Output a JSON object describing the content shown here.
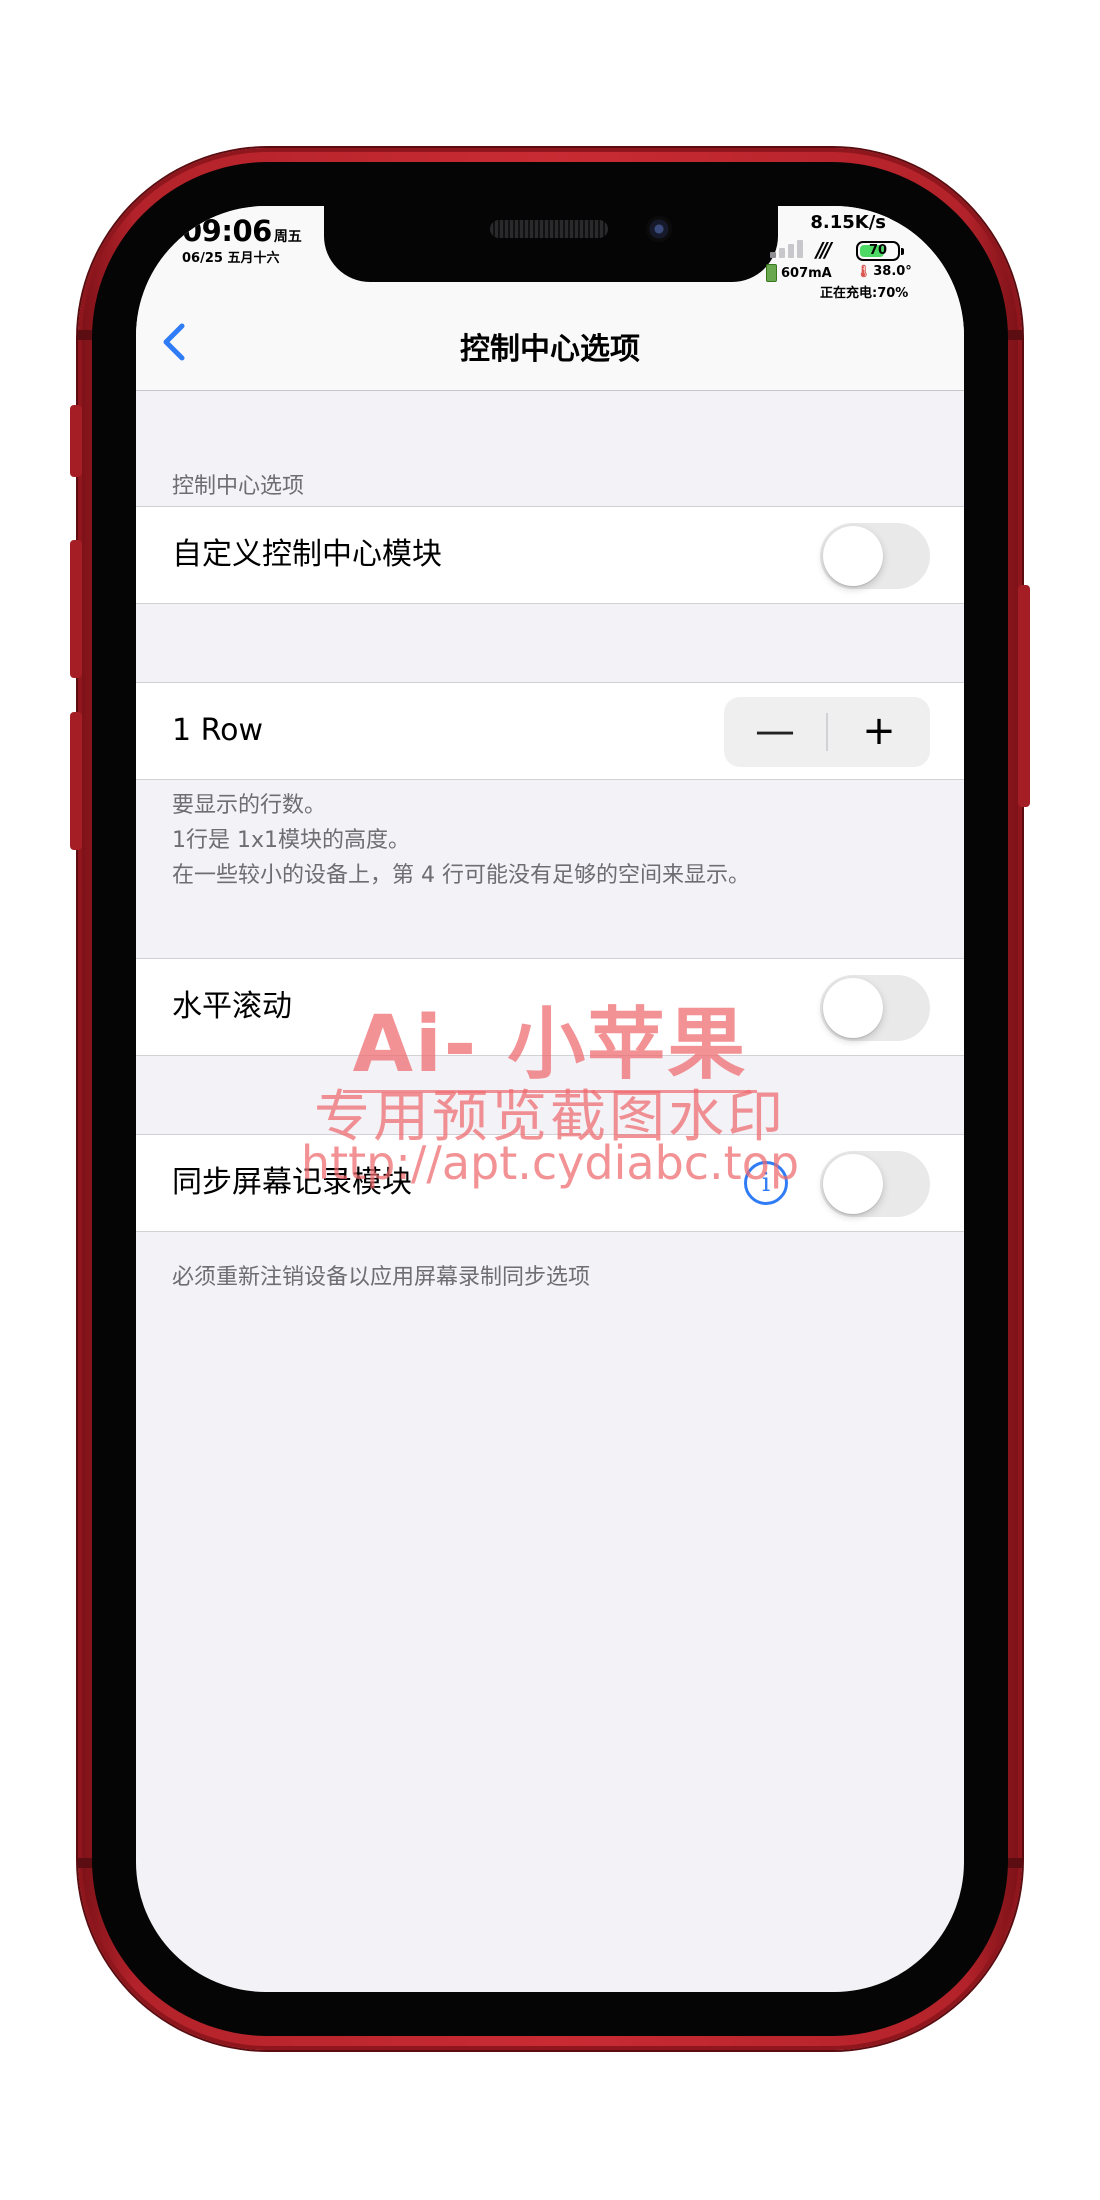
{
  "status_bar": {
    "time": "09:06",
    "weekday": "周五",
    "date": "06/25 五月十六",
    "net_speed": "8.15K/s",
    "carrier_glyph": "///",
    "battery_percent": "70",
    "battery_level": 0.7,
    "current": "607mA",
    "temperature": "38.0°",
    "charging_status": "正在充电:70%"
  },
  "nav": {
    "title": "控制中心选项"
  },
  "section1": {
    "header": "控制中心选项",
    "toggle_label": "自定义控制中心模块",
    "toggle_on": false
  },
  "rows": {
    "label": "1 Row",
    "minus": "—",
    "plus": "+",
    "footer": [
      "要显示的行数。",
      "1行是 1x1模块的高度。",
      "在一些较小的设备上，第 4 行可能没有足够的空间来显示。"
    ]
  },
  "horizontal": {
    "label": "水平滚动",
    "toggle_on": false
  },
  "screen_record": {
    "label": "同步屏幕记录模块",
    "info_glyph": "i",
    "toggle_on": false,
    "footer": "必须重新注销设备以应用屏幕录制同步选项"
  },
  "watermark": {
    "line1": "Ai- 小苹果",
    "line2": "专用预览截图水印",
    "line3": "http://apt.cydiabc.top"
  },
  "colors": {
    "accent": "#2f7cf6",
    "phone_red": "#c92b33",
    "background": "#f2f2f7",
    "watermark": "#ee686c",
    "battery_green": "#4cd964"
  }
}
